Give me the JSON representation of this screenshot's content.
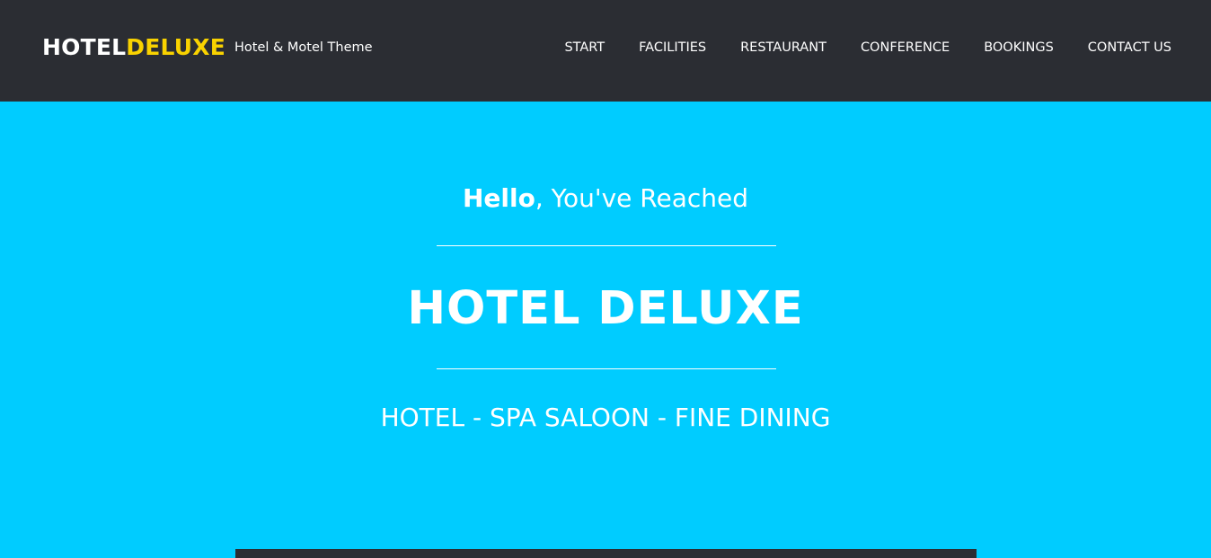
{
  "colors": {
    "navbar_background": "#2b2d33",
    "hero_background": "#00ccff",
    "brand_accent": "#f9d200",
    "text": "#ffffff"
  },
  "header": {
    "brand": {
      "part1": "HOTEL",
      "part2": "DELUXE",
      "tagline": "Hotel & Motel Theme"
    },
    "nav": [
      {
        "label": "START"
      },
      {
        "label": "FACILITIES"
      },
      {
        "label": "RESTAURANT"
      },
      {
        "label": "CONFERENCE"
      },
      {
        "label": "BOOKINGS"
      },
      {
        "label": "CONTACT US"
      }
    ]
  },
  "hero": {
    "greeting_bold": "Hello",
    "greeting_rest": ", You've Reached",
    "title": "HOTEL DELUXE",
    "subtitle": "HOTEL - SPA SALOON - FINE DINING"
  }
}
